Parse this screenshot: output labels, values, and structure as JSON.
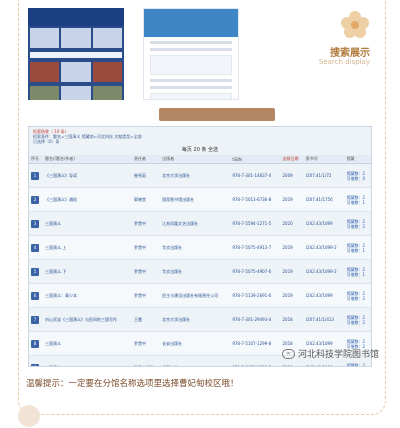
{
  "header": {
    "search_title": "搜索展示",
    "search_subtitle": "Search display"
  },
  "results": {
    "info_line1": "检索结果（ 10 条）",
    "info_line2": "检索条件：题名=三国演义 馆藏地=河北科技 文献类型=全部",
    "info_line3": "已选择（0）条",
    "pager": "每页 20 条 全选",
    "columns": [
      "序号",
      "题名/(题名/作者)",
      "责任者",
      "出版者",
      "ISBN",
      "出版日期",
      "索书号",
      "馆藏"
    ],
    "rows": [
      {
        "no": "1",
        "title": "《三国演义》导读",
        "author": "崔秀茹",
        "publisher": "北京大学出版社",
        "isbn": "978-7-301-14837-4",
        "year": "2009",
        "call": "I207.41/1/72",
        "status": [
          "馆藏数：2",
          "可借数：0"
        ]
      },
      {
        "no": "2",
        "title": "《三国演义》通俗",
        "author": "郭晓堂",
        "publisher": "国家图书馆出版社",
        "isbn": "978-7-5013-6736-8",
        "year": "2019",
        "call": "I207.41/1756",
        "status": [
          "馆藏数：2",
          "可借数：1"
        ]
      },
      {
        "no": "3",
        "title": "三国演义",
        "author": "罗贯中",
        "publisher": "江苏凤凰文艺出版社",
        "isbn": "978-7-5594-1271-5",
        "year": "2020",
        "call": "I242.43/1099",
        "status": [
          "馆藏数：2",
          "可借数：2"
        ]
      },
      {
        "no": "4",
        "title": "三国演义.上",
        "author": "罗贯中",
        "publisher": "华文出版社",
        "isbn": "978-7-5075-4913-7",
        "year": "2019",
        "call": "I242.43/1099-2",
        "status": [
          "馆藏数：2",
          "可借数：1"
        ]
      },
      {
        "no": "5",
        "title": "三国演义.下",
        "author": "罗贯中",
        "publisher": "华文出版社",
        "isbn": "978-7-5075-4907-6",
        "year": "2019",
        "call": "I242.43/1099-2",
        "status": [
          "馆藏数：2",
          "可借数：1"
        ]
      },
      {
        "no": "6",
        "title": "三国演义：青少本",
        "author": "罗贯中",
        "publisher": "民主与建设出版社有限责任公司",
        "isbn": "978-7-5139-2691-6",
        "year": "2019",
        "call": "I242.43/1099",
        "status": [
          "馆藏数：2",
          "可借数：2"
        ]
      },
      {
        "no": "7",
        "title": "刘心武谈《三国演义》与民间的三国写作",
        "author": "王雷",
        "publisher": "北京大学出版社",
        "isbn": "978-7-301-29493-4",
        "year": "2018",
        "call": "I207.41/1/413",
        "status": [
          "馆藏数：2",
          "可借数：2"
        ]
      },
      {
        "no": "8",
        "title": "三国演义",
        "author": "罗贯中",
        "publisher": "长安出版社",
        "isbn": "978-7-5107-1299-8",
        "year": "2018",
        "call": "I242.43/1099",
        "status": [
          "馆藏数：2",
          "可借数：2"
        ]
      },
      {
        "no": "9",
        "title": "三国演义",
        "author": "罗贯中评改",
        "publisher": "岳麓书社",
        "isbn": "978-7-5458-1601-3",
        "year": "2018",
        "call": "I242.43/1099",
        "status": [
          "馆藏数：2",
          "可借数：2"
        ]
      },
      {
        "no": "10",
        "title": "三国演义.第五卷.上",
        "author": "罗贯中主编",
        "publisher": "线装书局",
        "isbn": "978-7-5120-1979-1",
        "year": "2018",
        "call": "I242.43/1099",
        "status": [
          "馆藏数：2",
          "可借数：2"
        ]
      }
    ]
  },
  "watermark": "河北科技学院图书馆",
  "tip": "温馨提示：一定要在分馆名称选项里选择曹妃甸校区哦！",
  "colors": {
    "accent": "#b07a3c",
    "link": "#2f5fa7",
    "sort": "#c0392b"
  }
}
